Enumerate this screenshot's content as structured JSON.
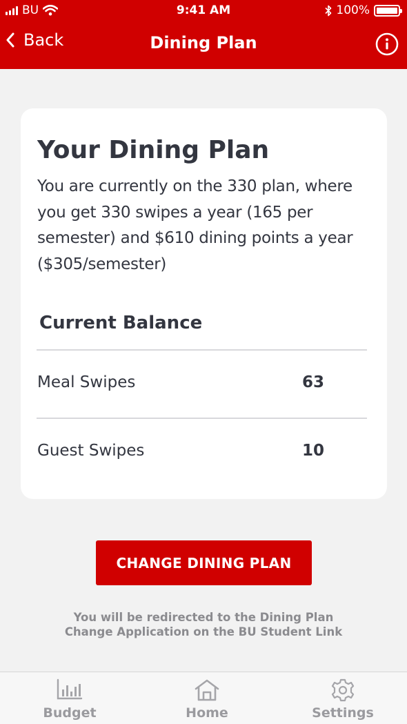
{
  "status_bar": {
    "carrier": "BU",
    "time": "9:41 AM",
    "battery": "100%"
  },
  "nav": {
    "back_label": "Back",
    "title": "Dining Plan",
    "back_icon": "chevron-left-icon",
    "info_icon": "info-icon"
  },
  "card": {
    "title": "Your Dining Plan",
    "description_lines": [
      "You are currently on the 330 plan, where",
      "you get 330 swipes a year (165 per",
      "semester) and $610 dining points a year",
      "($305/semester)"
    ],
    "balance_title": "Current Balance",
    "rows": [
      {
        "label": "Meal Swipes",
        "value": "63"
      },
      {
        "label": "Guest Swipes",
        "value": "10"
      }
    ]
  },
  "actions": {
    "change_plan_label": "CHANGE DINING PLAN",
    "redirect_note_lines": [
      "You will be redirected to the Dining Plan",
      "Change Application on the BU Student Link"
    ]
  },
  "tab_bar": {
    "tabs": [
      {
        "label": "Budget",
        "icon": "bar-chart-icon"
      },
      {
        "label": "Home",
        "icon": "home-icon"
      },
      {
        "label": "Settings",
        "icon": "gear-icon"
      }
    ]
  },
  "colors": {
    "brand_red": "#d00000",
    "background": "#f2f2f2",
    "text_dark": "#333640",
    "muted": "#8b8b8f"
  }
}
